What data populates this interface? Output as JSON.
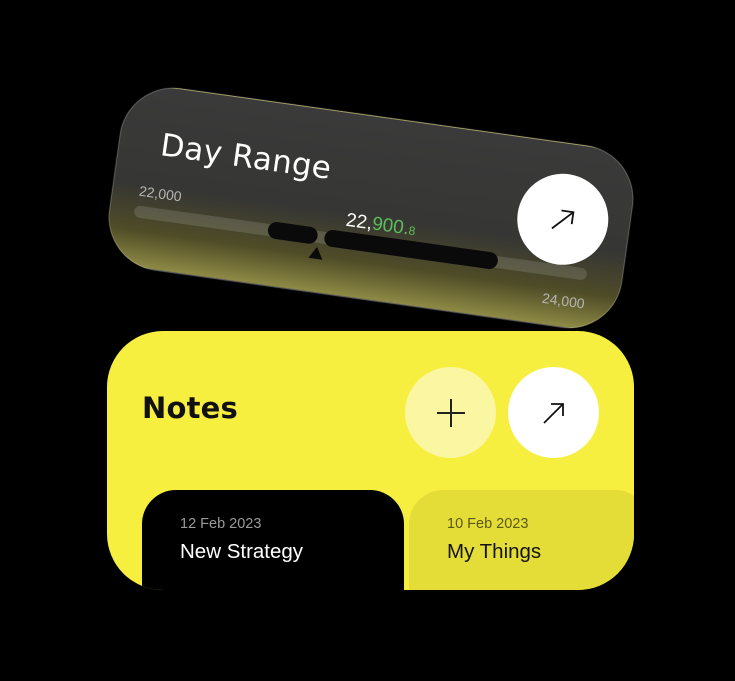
{
  "day_range": {
    "title": "Day Range",
    "low_label": "22,000",
    "high_label": "24,000",
    "current_whole": "22,",
    "current_decimal": "900.",
    "current_small": "8",
    "open_button_icon": "arrow-up-right-icon",
    "accent_color": "#5cbd5c"
  },
  "notes": {
    "title": "Notes",
    "add_button_icon": "plus-icon",
    "open_button_icon": "arrow-up-right-icon",
    "background_color": "#f7ef3f",
    "items": [
      {
        "date": "12 Feb 2023",
        "title": "New Strategy"
      },
      {
        "date": "10 Feb 2023",
        "title": "My Things"
      }
    ]
  }
}
